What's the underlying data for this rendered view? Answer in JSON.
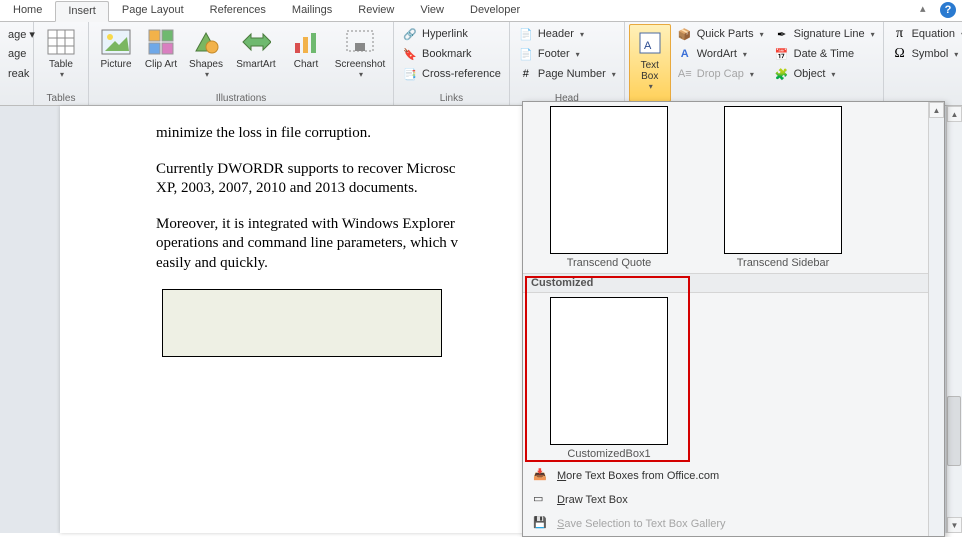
{
  "tabs": {
    "items": [
      "Home",
      "Insert",
      "Page Layout",
      "References",
      "Mailings",
      "Review",
      "View",
      "Developer"
    ],
    "active": "Insert"
  },
  "ribbon": {
    "pages": {
      "page_lbl": "age ▾",
      "break_lbl": "age\nreak"
    },
    "tables": {
      "group": "Tables",
      "table": "Table"
    },
    "illustrations": {
      "group": "Illustrations",
      "picture": "Picture",
      "clipart": "Clip\nArt",
      "shapes": "Shapes",
      "smartart": "SmartArt",
      "chart": "Chart",
      "screenshot": "Screenshot"
    },
    "links": {
      "group": "Links",
      "hyperlink": "Hyperlink",
      "bookmark": "Bookmark",
      "crossref": "Cross-reference"
    },
    "hf": {
      "group": "Head",
      "header": "Header",
      "footer": "Footer",
      "pagenum": "Page Number"
    },
    "text": {
      "textbox": "Text\nBox",
      "quickparts": "Quick Parts",
      "wordart": "WordArt",
      "dropcap": "Drop Cap",
      "sigline": "Signature Line",
      "datetime": "Date & Time",
      "object": "Object"
    },
    "symbols": {
      "equation": "Equation",
      "symbol": "Symbol"
    }
  },
  "document": {
    "p1": "minimize the loss in file corruption.",
    "p2": "Currently DWORDR supports to recover Microsc\nXP, 2003, 2007, 2010 and 2013 documents.",
    "p3": "Moreover, it is integrated with Windows Explorer\noperations and command line parameters, which v\neasily and quickly."
  },
  "gallery": {
    "item1": "Transcend Quote",
    "item2": "Transcend Sidebar",
    "header": "Customized",
    "item3": "CustomizedBox1",
    "more": "More Text Boxes from Office.com",
    "draw": "Draw Text Box",
    "save": "Save Selection to Text Box Gallery"
  }
}
